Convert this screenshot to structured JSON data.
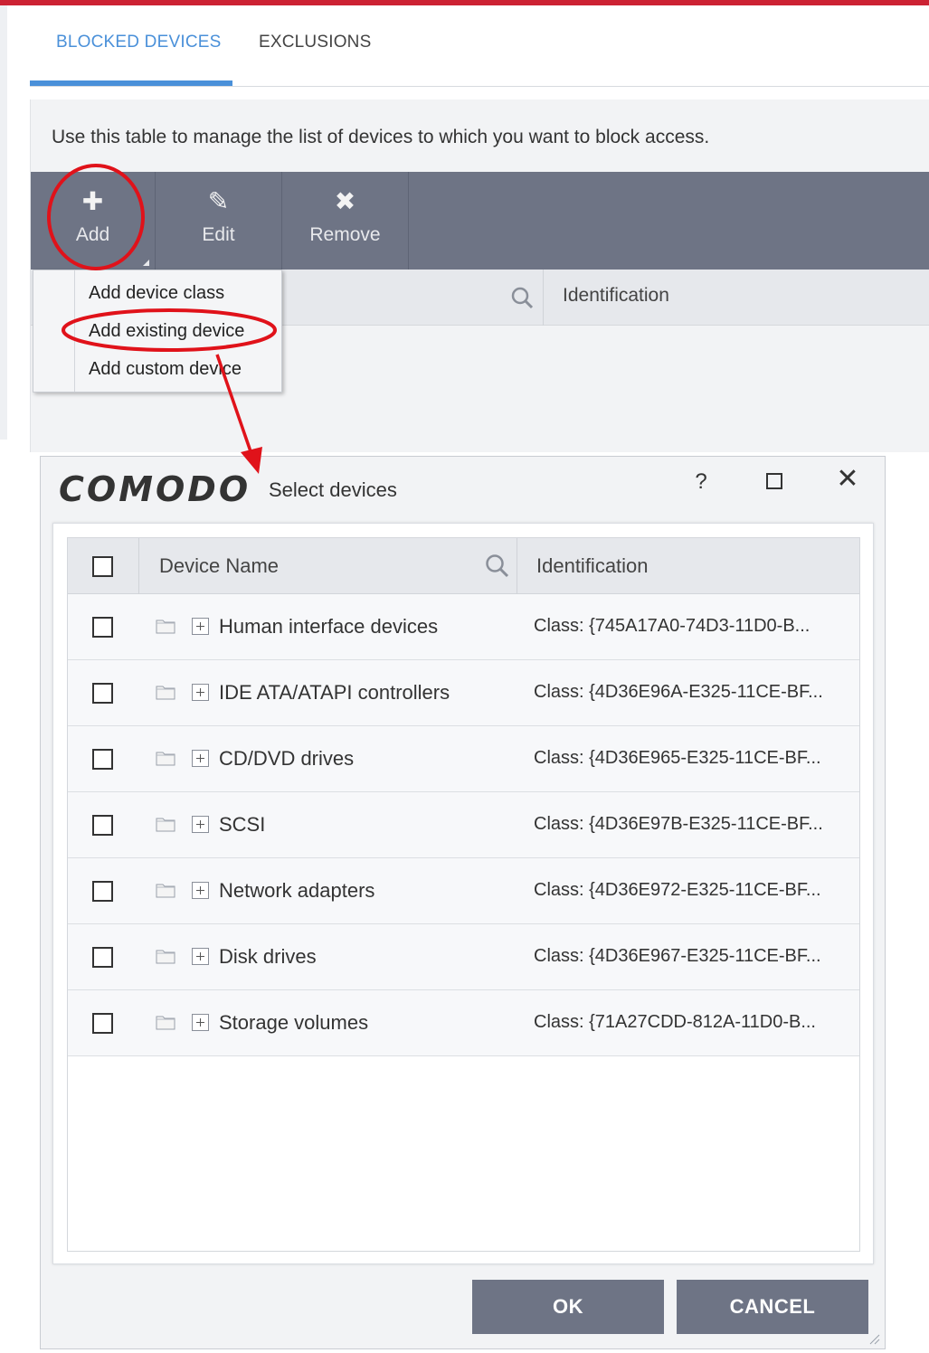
{
  "tabs": [
    {
      "label": "BLOCKED DEVICES",
      "active": true
    },
    {
      "label": "EXCLUSIONS",
      "active": false
    }
  ],
  "panel": {
    "description": "Use this table to manage the list of devices to which you want to block access."
  },
  "toolbar": {
    "add": {
      "label": "Add",
      "icon": "plus-icon"
    },
    "edit": {
      "label": "Edit",
      "icon": "pencil-icon"
    },
    "remove": {
      "label": "Remove",
      "icon": "x-icon"
    }
  },
  "background_table": {
    "identification_header": "Identification"
  },
  "add_menu": {
    "items": [
      "Add device class",
      "Add existing device",
      "Add custom device"
    ]
  },
  "dialog": {
    "logo": "COMODO",
    "title": "Select devices",
    "help_glyph": "?",
    "close_glyph": "✕",
    "columns": {
      "name": "Device Name",
      "identification": "Identification"
    },
    "rows": [
      {
        "name": "Human interface devices",
        "identification": "Class: {745A17A0-74D3-11D0-B..."
      },
      {
        "name": "IDE ATA/ATAPI controllers",
        "identification": "Class: {4D36E96A-E325-11CE-BF..."
      },
      {
        "name": "CD/DVD drives",
        "identification": "Class: {4D36E965-E325-11CE-BF..."
      },
      {
        "name": "SCSI",
        "identification": "Class: {4D36E97B-E325-11CE-BF..."
      },
      {
        "name": "Network adapters",
        "identification": "Class: {4D36E972-E325-11CE-BF..."
      },
      {
        "name": "Disk drives",
        "identification": "Class: {4D36E967-E325-11CE-BF..."
      },
      {
        "name": "Storage volumes",
        "identification": "Class: {71A27CDD-812A-11D0-B..."
      }
    ],
    "buttons": {
      "ok": "OK",
      "cancel": "CANCEL"
    }
  },
  "colors": {
    "accent": "#4a90d9",
    "toolbar": "#6e7485",
    "annotation": "#e0121a",
    "brand_bar": "#cc2233"
  }
}
